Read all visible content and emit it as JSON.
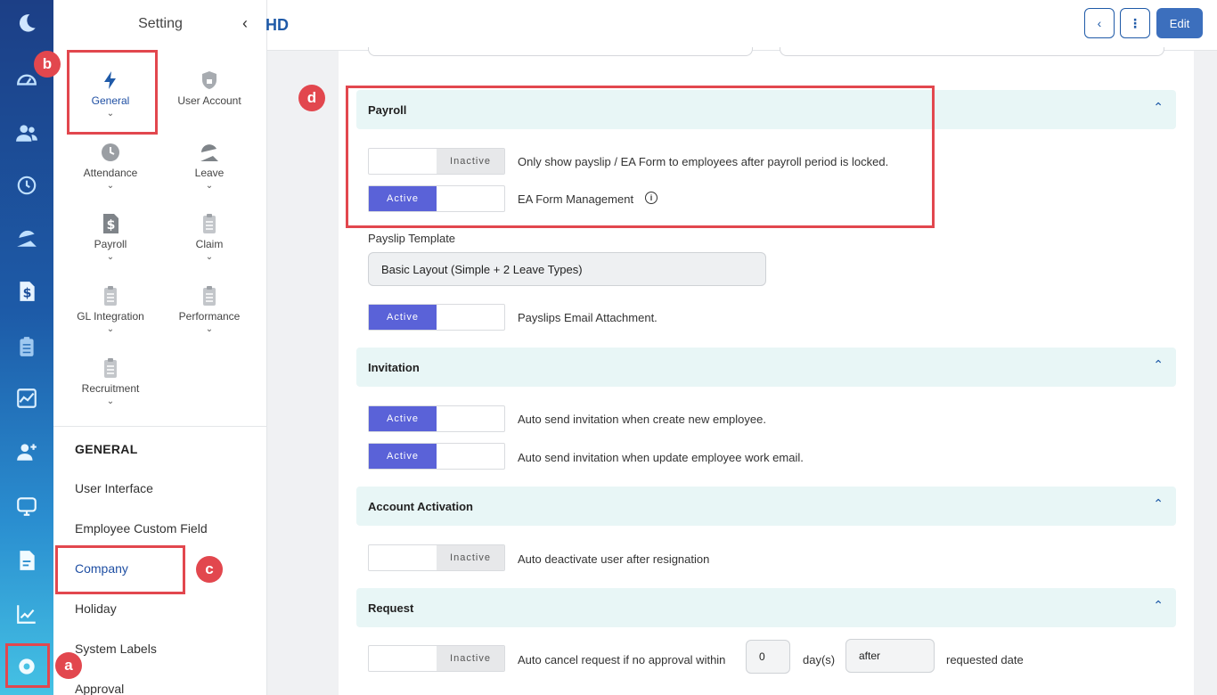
{
  "rail": {
    "icons": [
      "moon-logo-icon",
      "dashboard-icon",
      "people-icon",
      "history-icon",
      "leave-umbrella-icon",
      "payroll-dollar-icon",
      "clipboard-icon",
      "analytics-icon",
      "add-person-icon",
      "monitor-icon",
      "document-icon",
      "line-chart-icon",
      "settings-gear-icon"
    ]
  },
  "sidebar": {
    "title": "Setting",
    "back_glyph": "‹",
    "modules": [
      {
        "label": "General",
        "icon": "lightning-icon"
      },
      {
        "label": "User Account",
        "icon": "shield-lock-icon"
      },
      {
        "label": "Attendance",
        "icon": "clock-icon"
      },
      {
        "label": "Leave",
        "icon": "umbrella-icon"
      },
      {
        "label": "Payroll",
        "icon": "dollar-doc-icon"
      },
      {
        "label": "Claim",
        "icon": "clipboard-icon"
      },
      {
        "label": "GL Integration",
        "icon": "clipboard-icon"
      },
      {
        "label": "Performance",
        "icon": "clipboard-icon"
      },
      {
        "label": "Recruitment",
        "icon": "clipboard-icon"
      }
    ],
    "section_heading": "GENERAL",
    "links": [
      "User Interface",
      "Employee Custom Field",
      "Company",
      "Holiday",
      "System Labels",
      "Approval"
    ]
  },
  "topbar": {
    "title": "HD",
    "back_glyph": "‹",
    "more_glyph": "⋮",
    "edit_label": "Edit"
  },
  "sections": {
    "payroll": {
      "title": "Payroll",
      "rows": [
        {
          "state": "Inactive",
          "label": "Only show payslip / EA Form to employees after payroll period is locked."
        },
        {
          "state": "Active",
          "label": "EA Form Management"
        }
      ],
      "info_glyph": "i",
      "payslip_template_label": "Payslip Template",
      "payslip_template_value": "Basic Layout (Simple + 2 Leave Types)",
      "email_attachment": {
        "state": "Active",
        "label": "Payslips Email Attachment."
      }
    },
    "invitation": {
      "title": "Invitation",
      "rows": [
        {
          "state": "Active",
          "label": "Auto send invitation when create new employee."
        },
        {
          "state": "Active",
          "label": "Auto send invitation when update employee work email."
        }
      ]
    },
    "account_activation": {
      "title": "Account Activation",
      "rows": [
        {
          "state": "Inactive",
          "label": "Auto deactivate user after resignation"
        }
      ]
    },
    "request": {
      "title": "Request",
      "row": {
        "state": "Inactive",
        "label": "Auto cancel request if no approval within",
        "days_value": "0",
        "days_unit": "day(s)",
        "when_value": "after",
        "suffix": "requested date"
      }
    }
  },
  "chevron_up": "⌃",
  "chevron_down": "⌄",
  "callouts": [
    "a",
    "b",
    "c",
    "d"
  ],
  "colors": {
    "highlight": "#e2474e",
    "active_toggle": "#5a62d8",
    "brand_blue": "#1f5aa8",
    "section_bg": "#e8f6f6"
  }
}
